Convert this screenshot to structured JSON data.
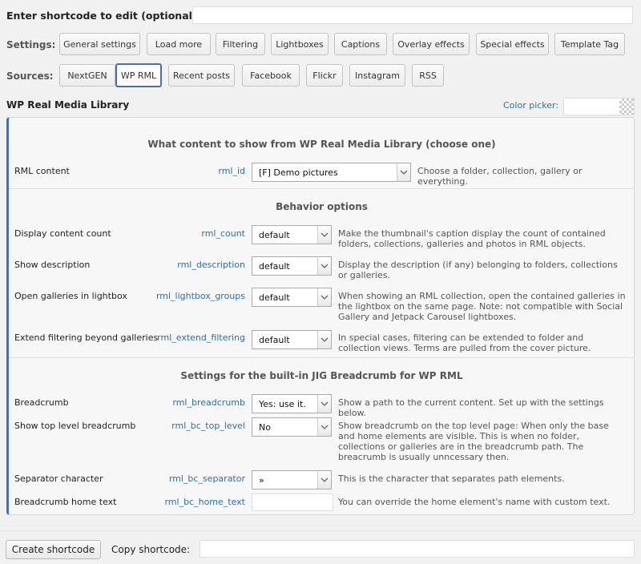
{
  "shortcode": {
    "label": "Enter shortcode to edit (optional):",
    "value": ""
  },
  "settings": {
    "label": "Settings:",
    "buttons": [
      "General settings",
      "Load more",
      "Filtering",
      "Lightboxes",
      "Captions",
      "Overlay effects",
      "Special effects",
      "Template Tag"
    ]
  },
  "sources": {
    "label": "Sources:",
    "buttons": [
      "NextGEN",
      "WP RML",
      "Recent posts",
      "Facebook",
      "Flickr",
      "Instagram",
      "RSS"
    ],
    "active": "WP RML"
  },
  "section": {
    "title": "WP Real Media Library",
    "color_picker_label": "Color picker:"
  },
  "groups": {
    "content": {
      "heading": "What content to show from WP Real Media Library (choose one)",
      "rows": [
        {
          "label": "RML content",
          "key": "rml_id",
          "value": "[F] Demo pictures",
          "desc": "Choose a folder, collection, gallery or everything."
        }
      ]
    },
    "behavior": {
      "heading": "Behavior options",
      "rows": [
        {
          "label": "Display content count",
          "key": "rml_count",
          "value": "default",
          "desc": "Make the thumbnail's caption display the count of contained folders, collections, galleries and photos in RML objects."
        },
        {
          "label": "Show description",
          "key": "rml_description",
          "value": "default",
          "desc": "Display the description (if any) belonging to folders, collections or galleries."
        },
        {
          "label": "Open galleries in lightbox",
          "key": "rml_lightbox_groups",
          "value": "default",
          "desc": "When showing an RML collection, open the contained galleries in the lightbox on the same page. Note: not compatible with Social Gallery and Jetpack Carousel lightboxes."
        },
        {
          "label": "Extend filtering beyond galleries",
          "key": "rml_extend_filtering",
          "value": "default",
          "desc": "In special cases, filtering can be extended to folder and collection views. Terms are pulled from the cover picture."
        }
      ]
    },
    "breadcrumb": {
      "heading": "Settings for the built-in JIG Breadcrumb for WP RML",
      "rows": [
        {
          "label": "Breadcrumb",
          "key": "rml_breadcrumb",
          "value": "Yes: use it.",
          "desc": "Show a path to the current content. Set up with the settings below."
        },
        {
          "label": "Show top level breadcrumb",
          "key": "rml_bc_top_level",
          "value": "No",
          "desc": "Show breadcrumb on the top level page: When only the base and home elements are visible. This is when no folder, collections or galleries are in the breadcrumb path. The breacrumb is usually unncessary then."
        },
        {
          "label": "Separator character",
          "key": "rml_bc_separator",
          "value": "»",
          "desc": "This is the character that separates path elements."
        },
        {
          "label": "Breadcrumb home text",
          "key": "rml_bc_home_text",
          "value": "",
          "desc": "You can override the home element's name with custom text."
        }
      ]
    }
  },
  "footer": {
    "create_label": "Create shortcode",
    "copy_label": "Copy shortcode:",
    "copy_value": ""
  },
  "icons": {
    "dropdown": "chevron-down-icon",
    "checker": "transparency-checker-icon"
  },
  "colors": {
    "accent": "#4a6fa5",
    "link": "#2e6fa7",
    "background": "#f1f1f1"
  }
}
